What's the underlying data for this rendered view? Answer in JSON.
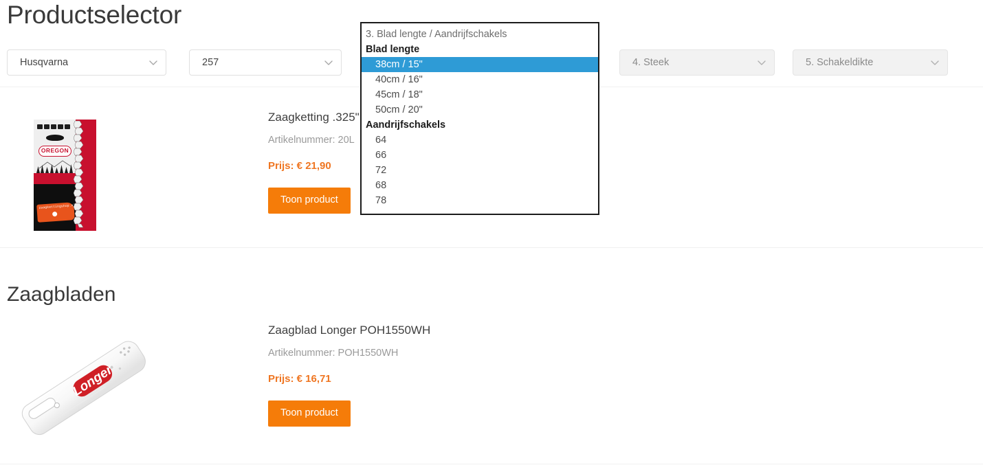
{
  "page": {
    "title": "Productselector"
  },
  "selectors": [
    {
      "id": "merk",
      "value": "Husqvarna",
      "disabled": false
    },
    {
      "id": "type",
      "value": "257",
      "disabled": false
    },
    {
      "id": "blad",
      "value": "3. Blad lengte / Aandrijfschakels",
      "disabled": false
    },
    {
      "id": "steek",
      "value": "4. Steek",
      "disabled": true
    },
    {
      "id": "dikte",
      "value": "5. Schakeldikte",
      "disabled": true
    }
  ],
  "dropdown": {
    "open": true,
    "placeholder": "3. Blad lengte / Aandrijfschakels",
    "selected_value": "38cm / 15\"",
    "highlight_color": "#2e9bd6",
    "groups": [
      {
        "label": "Blad lengte",
        "options": [
          "38cm / 15\"",
          "40cm / 16\"",
          "45cm / 18\"",
          "50cm / 20\""
        ]
      },
      {
        "label": "Aandrijfschakels",
        "options": [
          "64",
          "66",
          "72",
          "68",
          "78"
        ]
      }
    ]
  },
  "sections": [
    {
      "heading": "",
      "products": [
        {
          "name": "Zaagketting .325\"",
          "sku_label": "Artikelnummer: 20L",
          "price": "Prijs: € 21,90",
          "button": "Toon product",
          "image_name": "oregon-chainsaw-chain-box",
          "image_brand": "OREGON",
          "image_sticker_text": "zaagkettingshop.nl"
        }
      ]
    },
    {
      "heading": "Zaagbladen",
      "products": [
        {
          "name": "Zaagblad Longer POH1550WH",
          "sku_label": "Artikelnummer: POH1550WH",
          "price": "Prijs: € 16,71",
          "button": "Toon product",
          "image_name": "longer-guide-bar",
          "image_brand": "Longer"
        }
      ]
    }
  ],
  "colors": {
    "accent_orange": "#f57c09",
    "price_orange": "#ef7622",
    "highlight_blue": "#2e9bd6",
    "logo_red": "#c8102e",
    "text_dark": "#3a3a3a",
    "text_muted": "#9a9a9a"
  }
}
